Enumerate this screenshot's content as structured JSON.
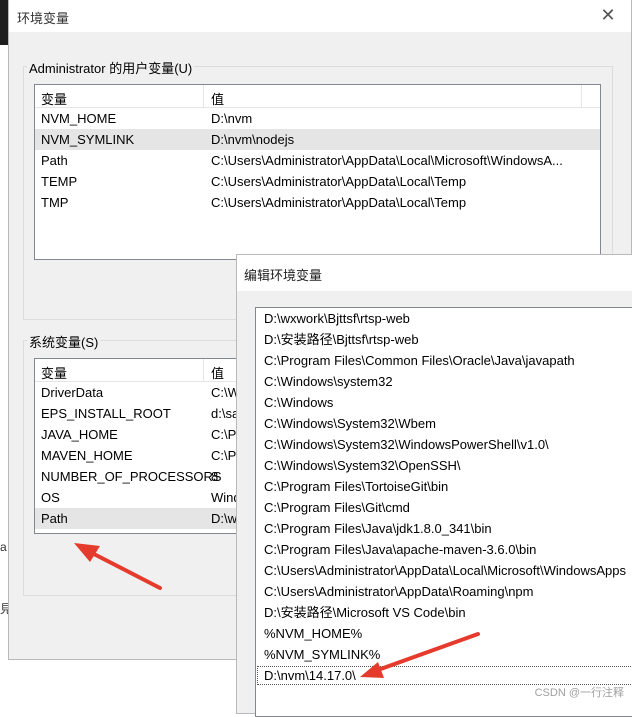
{
  "main_dialog": {
    "title": "环境变量",
    "close_glyph": "✕",
    "user_vars": {
      "legend": "Administrator 的用户变量(U)",
      "headers": [
        "变量",
        "值"
      ],
      "rows": [
        {
          "name": "NVM_HOME",
          "value": "D:\\nvm"
        },
        {
          "name": "NVM_SYMLINK",
          "value": "D:\\nvm\\nodejs"
        },
        {
          "name": "Path",
          "value": "C:\\Users\\Administrator\\AppData\\Local\\Microsoft\\WindowsA..."
        },
        {
          "name": "TEMP",
          "value": "C:\\Users\\Administrator\\AppData\\Local\\Temp"
        },
        {
          "name": "TMP",
          "value": "C:\\Users\\Administrator\\AppData\\Local\\Temp"
        }
      ]
    },
    "system_vars": {
      "legend": "系统变量(S)",
      "headers": [
        "变量",
        "值"
      ],
      "rows": [
        {
          "name": "DriverData",
          "value": "C:\\W"
        },
        {
          "name": "EPS_INSTALL_ROOT",
          "value": "d:\\sa"
        },
        {
          "name": "JAVA_HOME",
          "value": "C:\\Pr"
        },
        {
          "name": "MAVEN_HOME",
          "value": "C:\\Pr"
        },
        {
          "name": "NUMBER_OF_PROCESSORS",
          "value": "8"
        },
        {
          "name": "OS",
          "value": "Wind"
        },
        {
          "name": "Path",
          "value": "D:\\wx"
        }
      ]
    }
  },
  "edit_dialog": {
    "title": "编辑环境变量",
    "entries": [
      "D:\\wxwork\\Bjttsf\\rtsp-web",
      "D:\\安装路径\\Bjttsf\\rtsp-web",
      "C:\\Program Files\\Common Files\\Oracle\\Java\\javapath",
      "C:\\Windows\\system32",
      "C:\\Windows",
      "C:\\Windows\\System32\\Wbem",
      "C:\\Windows\\System32\\WindowsPowerShell\\v1.0\\",
      "C:\\Windows\\System32\\OpenSSH\\",
      "C:\\Program Files\\TortoiseGit\\bin",
      "C:\\Program Files\\Git\\cmd",
      "C:\\Program Files\\Java\\jdk1.8.0_341\\bin",
      "C:\\Program Files\\Java\\apache-maven-3.6.0\\bin",
      "C:\\Users\\Administrator\\AppData\\Local\\Microsoft\\WindowsApps",
      "C:\\Users\\Administrator\\AppData\\Roaming\\npm",
      "D:\\安装路径\\Microsoft VS Code\\bin",
      "%NVM_HOME%",
      "%NVM_SYMLINK%",
      "D:\\nvm\\14.17.0\\"
    ]
  },
  "left_edge": {
    "a": "a",
    "b": "見"
  },
  "watermark": "CSDN @一行注释",
  "colors": {
    "arrow": "#e53b2c",
    "dialog_bg": "#f0f0f0",
    "selected_row": "#e5e5e5"
  }
}
